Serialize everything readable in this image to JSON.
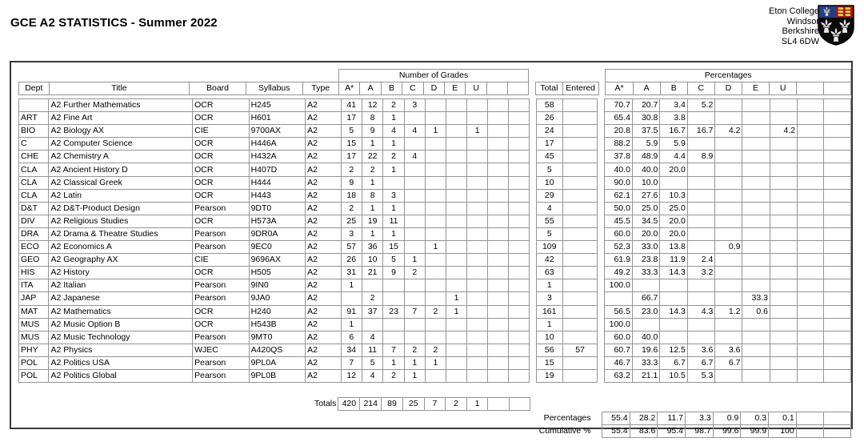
{
  "header": {
    "title": "GCE A2 STATISTICS - Summer 2022",
    "address": [
      "Eton College",
      "Windsor",
      "Berkshire",
      "SL4 6DW"
    ],
    "crest_icon": "eton-college-crest-icon"
  },
  "table": {
    "group_headers": {
      "grades": "Number of Grades",
      "percentages": "Percentages"
    },
    "columns": {
      "dept": "Dept",
      "title": "Title",
      "board": "Board",
      "syllabus": "Syllabus",
      "type": "Type",
      "total": "Total",
      "entered": "Entered",
      "grades": [
        "A*",
        "A",
        "B",
        "C",
        "D",
        "E",
        "U",
        "",
        ""
      ],
      "percentages": [
        "A*",
        "A",
        "B",
        "C",
        "D",
        "E",
        "U",
        "",
        ""
      ]
    },
    "rows": [
      {
        "dept": "",
        "title": "A2 Further Mathematics",
        "board": "OCR",
        "syllabus": "H245",
        "type": "A2",
        "grades": [
          "41",
          "12",
          "2",
          "3",
          "",
          "",
          "",
          "",
          ""
        ],
        "total": "58",
        "entered": "",
        "pct": [
          "70.7",
          "20.7",
          "3.4",
          "5.2",
          "",
          "",
          "",
          "",
          ""
        ]
      },
      {
        "dept": "ART",
        "title": "A2 Fine Art",
        "board": "OCR",
        "syllabus": "H601",
        "type": "A2",
        "grades": [
          "17",
          "8",
          "1",
          "",
          "",
          "",
          "",
          "",
          ""
        ],
        "total": "26",
        "entered": "",
        "pct": [
          "65.4",
          "30.8",
          "3.8",
          "",
          "",
          "",
          "",
          "",
          ""
        ]
      },
      {
        "dept": "BIO",
        "title": "A2 Biology AX",
        "board": "CIE",
        "syllabus": "9700AX",
        "type": "A2",
        "grades": [
          "5",
          "9",
          "4",
          "4",
          "1",
          "",
          "1",
          "",
          ""
        ],
        "total": "24",
        "entered": "",
        "pct": [
          "20.8",
          "37.5",
          "16.7",
          "16.7",
          "4.2",
          "",
          "4.2",
          "",
          ""
        ]
      },
      {
        "dept": "C",
        "title": "A2 Computer Science",
        "board": "OCR",
        "syllabus": "H446A",
        "type": "A2",
        "grades": [
          "15",
          "1",
          "1",
          "",
          "",
          "",
          "",
          "",
          ""
        ],
        "total": "17",
        "entered": "",
        "pct": [
          "88.2",
          "5.9",
          "5.9",
          "",
          "",
          "",
          "",
          "",
          ""
        ]
      },
      {
        "dept": "CHE",
        "title": "A2 Chemistry A",
        "board": "OCR",
        "syllabus": "H432A",
        "type": "A2",
        "grades": [
          "17",
          "22",
          "2",
          "4",
          "",
          "",
          "",
          "",
          ""
        ],
        "total": "45",
        "entered": "",
        "pct": [
          "37.8",
          "48.9",
          "4.4",
          "8.9",
          "",
          "",
          "",
          "",
          ""
        ]
      },
      {
        "dept": "CLA",
        "title": "A2 Ancient History D",
        "board": "OCR",
        "syllabus": "H407D",
        "type": "A2",
        "grades": [
          "2",
          "2",
          "1",
          "",
          "",
          "",
          "",
          "",
          ""
        ],
        "total": "5",
        "entered": "",
        "pct": [
          "40.0",
          "40.0",
          "20.0",
          "",
          "",
          "",
          "",
          "",
          ""
        ]
      },
      {
        "dept": "CLA",
        "title": "A2  Classical Greek",
        "board": "OCR",
        "syllabus": "H444",
        "type": "A2",
        "grades": [
          "9",
          "1",
          "",
          "",
          "",
          "",
          "",
          "",
          ""
        ],
        "total": "10",
        "entered": "",
        "pct": [
          "90.0",
          "10.0",
          "",
          "",
          "",
          "",
          "",
          "",
          ""
        ]
      },
      {
        "dept": "CLA",
        "title": "A2 Latin",
        "board": "OCR",
        "syllabus": "H443",
        "type": "A2",
        "grades": [
          "18",
          "8",
          "3",
          "",
          "",
          "",
          "",
          "",
          ""
        ],
        "total": "29",
        "entered": "",
        "pct": [
          "62.1",
          "27.6",
          "10.3",
          "",
          "",
          "",
          "",
          "",
          ""
        ]
      },
      {
        "dept": "D&T",
        "title": "A2 D&T-Product Design",
        "board": "Pearson",
        "syllabus": "9DT0",
        "type": "A2",
        "grades": [
          "2",
          "1",
          "1",
          "",
          "",
          "",
          "",
          "",
          ""
        ],
        "total": "4",
        "entered": "",
        "pct": [
          "50.0",
          "25.0",
          "25.0",
          "",
          "",
          "",
          "",
          "",
          ""
        ]
      },
      {
        "dept": "DIV",
        "title": "A2 Religious Studies",
        "board": "OCR",
        "syllabus": "H573A",
        "type": "A2",
        "grades": [
          "25",
          "19",
          "11",
          "",
          "",
          "",
          "",
          "",
          ""
        ],
        "total": "55",
        "entered": "",
        "pct": [
          "45.5",
          "34.5",
          "20.0",
          "",
          "",
          "",
          "",
          "",
          ""
        ]
      },
      {
        "dept": "DRA",
        "title": "A2 Drama & Theatre Studies",
        "board": "Pearson",
        "syllabus": "9DR0A",
        "type": "A2",
        "grades": [
          "3",
          "1",
          "1",
          "",
          "",
          "",
          "",
          "",
          ""
        ],
        "total": "5",
        "entered": "",
        "pct": [
          "60.0",
          "20.0",
          "20.0",
          "",
          "",
          "",
          "",
          "",
          ""
        ]
      },
      {
        "dept": "ECO",
        "title": "A2 Economics A",
        "board": "Pearson",
        "syllabus": "9EC0",
        "type": "A2",
        "grades": [
          "57",
          "36",
          "15",
          "",
          "1",
          "",
          "",
          "",
          ""
        ],
        "total": "109",
        "entered": "",
        "pct": [
          "52.3",
          "33.0",
          "13.8",
          "",
          "0.9",
          "",
          "",
          "",
          ""
        ]
      },
      {
        "dept": "GEO",
        "title": "A2 Geography AX",
        "board": "CIE",
        "syllabus": "9696AX",
        "type": "A2",
        "grades": [
          "26",
          "10",
          "5",
          "1",
          "",
          "",
          "",
          "",
          ""
        ],
        "total": "42",
        "entered": "",
        "pct": [
          "61.9",
          "23.8",
          "11.9",
          "2.4",
          "",
          "",
          "",
          "",
          ""
        ]
      },
      {
        "dept": "HIS",
        "title": "A2 History",
        "board": "OCR",
        "syllabus": "H505",
        "type": "A2",
        "grades": [
          "31",
          "21",
          "9",
          "2",
          "",
          "",
          "",
          "",
          ""
        ],
        "total": "63",
        "entered": "",
        "pct": [
          "49.2",
          "33.3",
          "14.3",
          "3.2",
          "",
          "",
          "",
          "",
          ""
        ]
      },
      {
        "dept": "ITA",
        "title": "A2 Italian",
        "board": "Pearson",
        "syllabus": "9IN0",
        "type": "A2",
        "grades": [
          "1",
          "",
          "",
          "",
          "",
          "",
          "",
          "",
          ""
        ],
        "total": "1",
        "entered": "",
        "pct": [
          "100.0",
          "",
          "",
          "",
          "",
          "",
          "",
          "",
          ""
        ]
      },
      {
        "dept": "JAP",
        "title": "A2 Japanese",
        "board": "Pearson",
        "syllabus": "9JA0",
        "type": "A2",
        "grades": [
          "",
          "2",
          "",
          "",
          "",
          "1",
          "",
          "",
          ""
        ],
        "total": "3",
        "entered": "",
        "pct": [
          "",
          "66.7",
          "",
          "",
          "",
          "33.3",
          "",
          "",
          ""
        ]
      },
      {
        "dept": "MAT",
        "title": "A2 Mathematics",
        "board": "OCR",
        "syllabus": "H240",
        "type": "A2",
        "grades": [
          "91",
          "37",
          "23",
          "7",
          "2",
          "1",
          "",
          "",
          ""
        ],
        "total": "161",
        "entered": "",
        "pct": [
          "56.5",
          "23.0",
          "14.3",
          "4.3",
          "1.2",
          "0.6",
          "",
          "",
          ""
        ]
      },
      {
        "dept": "MUS",
        "title": "A2 Music Option B",
        "board": "OCR",
        "syllabus": "H543B",
        "type": "A2",
        "grades": [
          "1",
          "",
          "",
          "",
          "",
          "",
          "",
          "",
          ""
        ],
        "total": "1",
        "entered": "",
        "pct": [
          "100.0",
          "",
          "",
          "",
          "",
          "",
          "",
          "",
          ""
        ]
      },
      {
        "dept": "MUS",
        "title": "A2 Music Technology",
        "board": "Pearson",
        "syllabus": "9MT0",
        "type": "A2",
        "grades": [
          "6",
          "4",
          "",
          "",
          "",
          "",
          "",
          "",
          ""
        ],
        "total": "10",
        "entered": "",
        "pct": [
          "60.0",
          "40.0",
          "",
          "",
          "",
          "",
          "",
          "",
          ""
        ]
      },
      {
        "dept": "PHY",
        "title": "A2 Physics",
        "board": "WJEC",
        "syllabus": "A420QS",
        "type": "A2",
        "grades": [
          "34",
          "11",
          "7",
          "2",
          "2",
          "",
          "",
          "",
          ""
        ],
        "total": "56",
        "entered": "57",
        "pct": [
          "60.7",
          "19.6",
          "12.5",
          "3.6",
          "3.6",
          "",
          "",
          "",
          ""
        ]
      },
      {
        "dept": "POL",
        "title": "A2 Politics USA",
        "board": "Pearson",
        "syllabus": "9PL0A",
        "type": "A2",
        "grades": [
          "7",
          "5",
          "1",
          "1",
          "1",
          "",
          "",
          "",
          ""
        ],
        "total": "15",
        "entered": "",
        "pct": [
          "46.7",
          "33.3",
          "6.7",
          "6.7",
          "6.7",
          "",
          "",
          "",
          ""
        ]
      },
      {
        "dept": "POL",
        "title": "A2 Politics Global",
        "board": "Pearson",
        "syllabus": "9PL0B",
        "type": "A2",
        "grades": [
          "12",
          "4",
          "2",
          "1",
          "",
          "",
          "",
          "",
          ""
        ],
        "total": "19",
        "entered": "",
        "pct": [
          "63.2",
          "21.1",
          "10.5",
          "5.3",
          "",
          "",
          "",
          "",
          ""
        ]
      }
    ],
    "footer": {
      "totals_label": "Totals",
      "totals": [
        "420",
        "214",
        "89",
        "25",
        "7",
        "2",
        "1",
        "",
        ""
      ],
      "percentages_label": "Percentages",
      "percentages": [
        "55.4",
        "28.2",
        "11.7",
        "3.3",
        "0.9",
        "0.3",
        "0.1",
        "",
        ""
      ],
      "cumulative_label": "Cumulative %",
      "cumulative": [
        "55.4",
        "83.6",
        "95.4",
        "98.7",
        "99.6",
        "99.9",
        "100",
        "",
        ""
      ]
    }
  }
}
